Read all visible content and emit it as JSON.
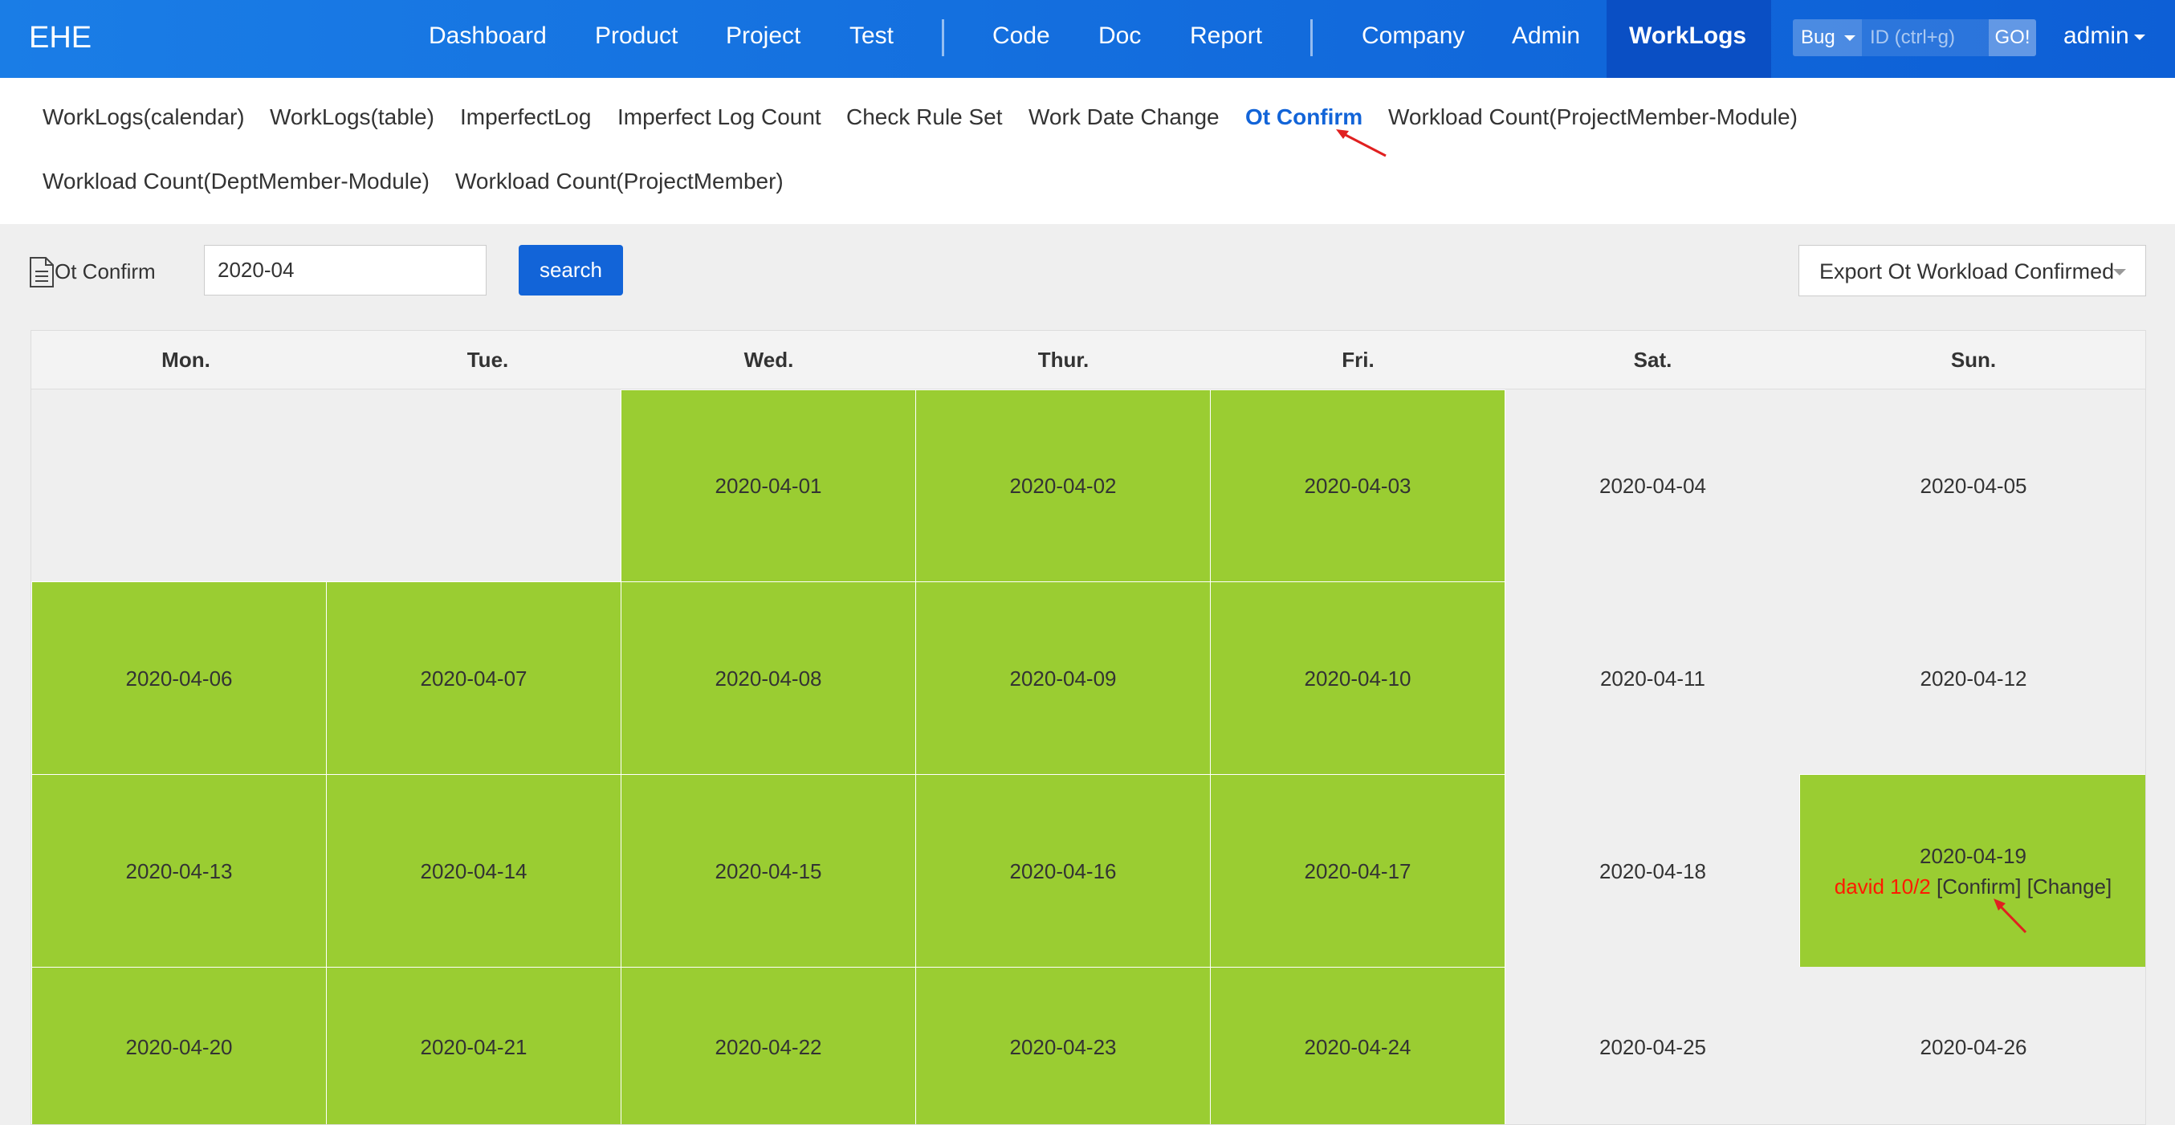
{
  "topnav": {
    "brand": "EHE",
    "items": [
      "Dashboard",
      "Product",
      "Project",
      "Test",
      "Code",
      "Doc",
      "Report",
      "Company",
      "Admin"
    ],
    "active": "WorkLogs",
    "search": {
      "type": "Bug",
      "placeholder": "ID (ctrl+g)",
      "go": "GO!"
    },
    "user": "admin"
  },
  "subnav": {
    "items": [
      "WorkLogs(calendar)",
      "WorkLogs(table)",
      "ImperfectLog",
      "Imperfect Log Count",
      "Check Rule Set",
      "Work Date Change",
      "Ot Confirm",
      "Workload Count(ProjectMember-Module)",
      "Workload Count(DeptMember-Module)",
      "Workload Count(ProjectMember)"
    ],
    "active": "Ot Confirm"
  },
  "toolbar": {
    "label": "Ot Confirm",
    "month_value": "2020-04",
    "search_label": "search",
    "export_label": "Export Ot Workload Confirmed"
  },
  "calendar": {
    "weekdays": [
      "Mon.",
      "Tue.",
      "Wed.",
      "Thur.",
      "Fri.",
      "Sat.",
      "Sun."
    ],
    "weeks": [
      [
        "",
        "",
        "2020-04-01",
        "2020-04-02",
        "2020-04-03",
        "2020-04-04",
        "2020-04-05"
      ],
      [
        "2020-04-06",
        "2020-04-07",
        "2020-04-08",
        "2020-04-09",
        "2020-04-10",
        "2020-04-11",
        "2020-04-12"
      ],
      [
        "2020-04-13",
        "2020-04-14",
        "2020-04-15",
        "2020-04-16",
        "2020-04-17",
        "2020-04-18",
        "2020-04-19"
      ],
      [
        "2020-04-20",
        "2020-04-21",
        "2020-04-22",
        "2020-04-23",
        "2020-04-24",
        "2020-04-25",
        "2020-04-26"
      ]
    ],
    "ot_entry": {
      "date": "2020-04-19",
      "user": "david 10/2",
      "confirm": "[Confirm]",
      "change": "[Change]"
    },
    "colors": {
      "workday": "#9acd32",
      "weekend": "#efefef",
      "accent": "#1264d8",
      "ot_user": "#ff1a00"
    }
  }
}
